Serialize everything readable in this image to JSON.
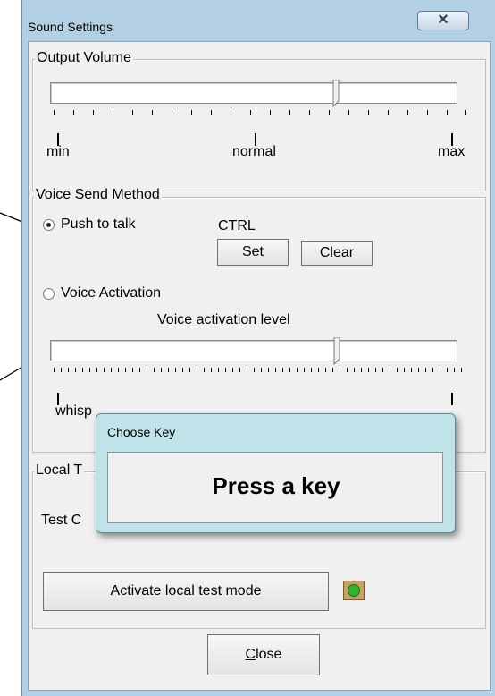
{
  "window": {
    "title": "Sound Settings",
    "close_glyph": "✕"
  },
  "output_volume": {
    "legend": "Output Volume",
    "level": 0.58,
    "labels": {
      "min": "min",
      "mid": "normal",
      "max": "max"
    }
  },
  "voice_send": {
    "legend": "Voice Send Method",
    "push_to_talk": {
      "label": "Push to talk",
      "checked": true
    },
    "hotkey": "CTRL",
    "set_button": "Set",
    "clear_button": "Clear",
    "voice_activation": {
      "label": "Voice Activation",
      "checked": false
    },
    "activation_level_label": "Voice activation level",
    "activation_level": 0.72,
    "whisper_label": "whisp"
  },
  "local_test": {
    "legend_visible": "Local T",
    "test_label_visible": "Test C",
    "activate_button": "Activate local test mode",
    "indicator_color": "#2db52d"
  },
  "footer": {
    "close_button": "Close",
    "close_mnemonic": "C",
    "close_rest": "lose"
  },
  "popup": {
    "title": "Choose Key",
    "message": "Press a key"
  },
  "annotations": {
    "arrow_color": "#000000"
  }
}
